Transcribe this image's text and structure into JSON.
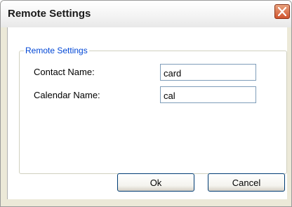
{
  "window": {
    "title": "Remote Settings"
  },
  "group": {
    "legend": "Remote Settings"
  },
  "fields": {
    "contact": {
      "label": "Contact Name:",
      "value": "card"
    },
    "calendar": {
      "label": "Calendar Name:",
      "value": "cal"
    }
  },
  "buttons": {
    "ok": "Ok",
    "cancel": "Cancel"
  },
  "icons": {
    "close": "close-icon"
  },
  "colors": {
    "close_button": "#d0542e",
    "legend_text": "#0046d5",
    "input_border": "#7f9db9",
    "button_border": "#003c74"
  }
}
